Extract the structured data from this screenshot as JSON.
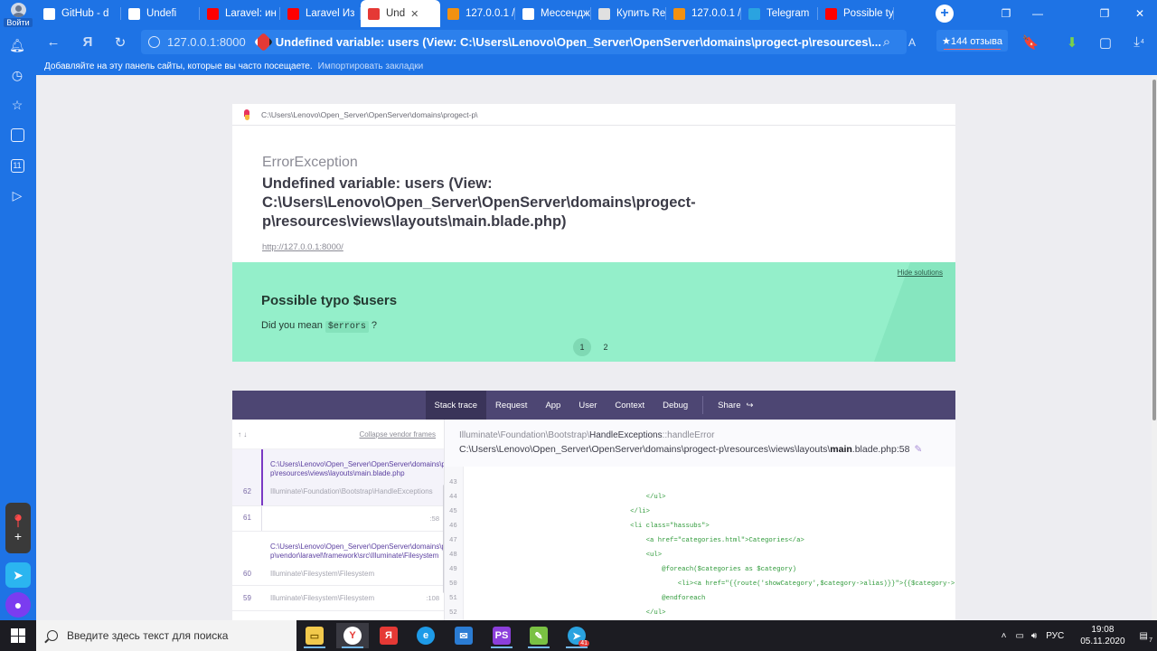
{
  "browser": {
    "login_label": "Войти",
    "tabs": [
      {
        "label": "GitHub - d",
        "icon": "github-icon",
        "color": "#ffffff"
      },
      {
        "label": "Undefi",
        "icon": "document-icon",
        "color": "#ffffff"
      },
      {
        "label": "Laravel: ин",
        "icon": "youtube-icon",
        "color": "#ff0000"
      },
      {
        "label": "Laravel Из",
        "icon": "youtube-icon",
        "color": "#ff0000"
      },
      {
        "label": "Und",
        "icon": "pencil-icon",
        "color": "#e53935",
        "active": true
      },
      {
        "label": "127.0.0.1 /",
        "icon": "phpmyadmin-icon",
        "color": "#f29111"
      },
      {
        "label": "Мессендж",
        "icon": "messenger-icon",
        "color": "#ffffff"
      },
      {
        "label": "Купить Re",
        "icon": "shop-icon",
        "color": "#e0e0e0"
      },
      {
        "label": "127.0.0.1 /",
        "icon": "phpmyadmin-icon",
        "color": "#f29111"
      },
      {
        "label": "Telegram",
        "icon": "telegram-icon",
        "color": "#2aa3e0"
      },
      {
        "label": "Possible ty",
        "icon": "yandex-icon",
        "color": "#ff0000"
      }
    ],
    "url_host": "127.0.0.1:8000",
    "page_title": "Undefined variable: users (View: C:\\Users\\Lenovo\\Open_Server\\OpenServer\\domains\\progect-p\\resources\\...",
    "reviews_label": "★144 отзыва",
    "bookmarks_hint": "Добавляйте на эту панель сайты, которые вы часто посещаете.",
    "bookmarks_import": "Импортировать закладки",
    "downloads_badge": "4",
    "sidebar_badge": "11"
  },
  "page": {
    "crumb": "C:\\Users\\Lenovo\\Open_Server\\OpenServer\\domains\\progect-p\\",
    "exception_class": "ErrorException",
    "exception_message": "Undefined variable: users (View: C:\\Users\\Lenovo\\Open_Server\\OpenServer\\domains\\progect-p\\resources\\views\\layouts\\main.blade.php)",
    "request_url": "http://127.0.0.1:8000/",
    "solution": {
      "hide_label": "Hide solutions",
      "title": "Possible typo $users",
      "text_before": "Did you mean",
      "suggestion": "$errors",
      "text_after": "?",
      "pages": [
        "1",
        "2"
      ]
    },
    "stack_tabs": [
      "Stack trace",
      "Request",
      "App",
      "User",
      "Context",
      "Debug",
      "Share"
    ],
    "frames_header": {
      "arrows": "↑ ↓",
      "collapse": "Collapse vendor frames"
    },
    "frames": [
      {
        "num": "",
        "path": "C:\\Users\\Lenovo\\Open_Server\\OpenServer\\domains\\progect-p\\resources\\views\\layouts\\main.blade.php",
        "cls": "",
        "line": ""
      },
      {
        "num": "62",
        "path": "",
        "cls": "Illuminate\\Foundation\\Bootstrap\\HandleExceptions",
        "line": ""
      },
      {
        "num": "61",
        "path": "",
        "cls": "",
        "line": ":58"
      },
      {
        "num": "60",
        "path": "C:\\Users\\Lenovo\\Open_Server\\OpenServer\\domains\\progect-p\\vendor\\laravel\\framework\\src\\Illuminate\\Filesystem",
        "cls": "Illuminate\\Filesystem\\Filesystem",
        "line": ""
      },
      {
        "num": "59",
        "path": "",
        "cls": "Illuminate\\Filesystem\\Filesystem",
        "line": ":108"
      }
    ],
    "code_header_ns": "Illuminate\\Foundation\\Bootstrap\\",
    "code_header_class": "HandleExceptions",
    "code_header_method": "::handleError",
    "code_file_prefix": "C:\\Users\\Lenovo\\Open_Server\\OpenServer\\domains\\progect-p\\resources\\views\\layouts\\",
    "code_file_name": "main",
    "code_file_suffix": ".blade.php:58",
    "code_lines": [
      {
        "n": "43",
        "t": ""
      },
      {
        "n": "44",
        "t": "                                            </ul>"
      },
      {
        "n": "45",
        "t": "                                        </li>"
      },
      {
        "n": "46",
        "t": "                                        <li class=\"hassubs\">"
      },
      {
        "n": "47",
        "t": "                                            <a href=\"categories.html\">Categories</a>"
      },
      {
        "n": "48",
        "t": "                                            <ul>"
      },
      {
        "n": "49",
        "t": "                                                @foreach($categories as $category)"
      },
      {
        "n": "50",
        "t": "                                                    <li><a href=\"{{route('showCategory',$category->alias)}}\">{{$category->ti"
      },
      {
        "n": "51",
        "t": "                                                @endforeach"
      },
      {
        "n": "52",
        "t": "                                            </ul>"
      }
    ]
  },
  "taskbar": {
    "search_placeholder": "Введите здесь текст для поиска",
    "language": "РУС",
    "time": "19:08",
    "date": "05.11.2020",
    "notification_count": "7",
    "telegram_badge": "41"
  }
}
